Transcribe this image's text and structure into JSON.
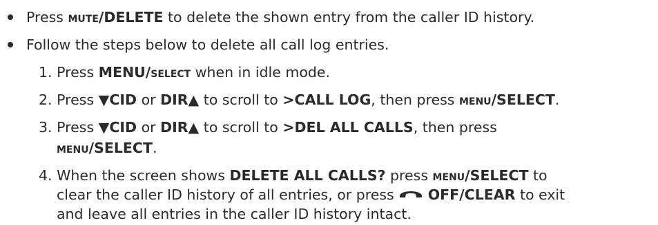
{
  "bullet1": {
    "pre": "Press ",
    "key_sc": "mute",
    "key_rest": "/DELETE",
    "post": " to delete the shown entry from the caller ID history."
  },
  "bullet2": {
    "text": "Follow the steps below to delete all call log entries."
  },
  "steps": [
    {
      "num": "1.",
      "pre": "Press ",
      "menu": "MENU/",
      "select_sc": "select",
      "post": " when in idle mode."
    },
    {
      "num": "2.",
      "pre": "Press ",
      "cid": "▼CID",
      "or": " or ",
      "dir": "DIR▲",
      "mid": " to scroll to ",
      "target": ">CALL LOG",
      "then": ", then press ",
      "menu_sc": "menu",
      "menu_rest": "/SELECT",
      "end": "."
    },
    {
      "num": "3.",
      "pre": "Press ",
      "cid": "▼CID",
      "or": " or ",
      "dir": "DIR▲",
      "mid": " to scroll to ",
      "target": ">DEL ALL CALLS",
      "then": ", then press",
      "menu_sc": "menu",
      "menu_rest": "/SELECT",
      "end": "."
    },
    {
      "num": "4.",
      "pre": "When the screen shows ",
      "prompt": "DELETE ALL CALLS?",
      "mid": " press ",
      "menu_sc": "menu",
      "menu_rest": "/SELECT",
      "post1": " to",
      "line2_pre": "clear the caller ID history of all entries, or press ",
      "off": "OFF/CLEAR",
      "line2_post": " to exit",
      "line3": "and leave all entries in the caller ID history intact."
    }
  ],
  "icons": {
    "off_key": "phone-hangup-icon"
  }
}
